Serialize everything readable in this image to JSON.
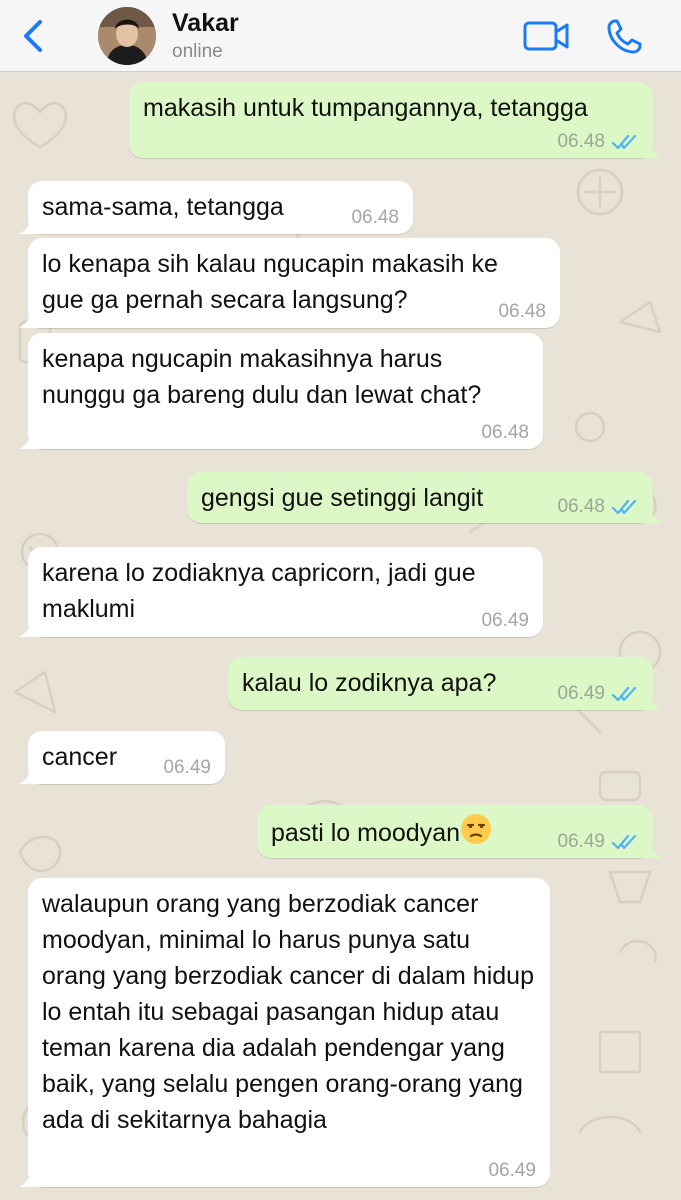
{
  "header": {
    "back_icon": "chevron-left-icon",
    "contact_name": "Vakar",
    "status": "online",
    "video_icon": "video-camera-icon",
    "call_icon": "phone-icon",
    "accent_color": "#1a7cf5"
  },
  "chat": {
    "wallpaper_color": "#e9e2d6",
    "incoming_bubble_color": "#ffffff",
    "outgoing_bubble_color": "#dcf8c6",
    "read_tick_color": "#4fb3f6",
    "messages": [
      {
        "dir": "out",
        "text": "makasih untuk tumpangannya, tetangga",
        "time": "06.48",
        "read": true
      },
      {
        "dir": "in",
        "text": "sama-sama, tetangga",
        "time": "06.48"
      },
      {
        "dir": "in",
        "text": "lo kenapa sih kalau ngucapin makasih ke gue ga pernah secara langsung?",
        "time": "06.48"
      },
      {
        "dir": "in",
        "text": "kenapa ngucapin makasihnya harus nunggu ga bareng dulu dan lewat chat?",
        "time": "06.48"
      },
      {
        "dir": "out",
        "text": "gengsi gue setinggi langit",
        "time": "06.48",
        "read": true
      },
      {
        "dir": "in",
        "text": "karena lo zodiaknya capricorn, jadi gue maklumi",
        "time": "06.49"
      },
      {
        "dir": "out",
        "text": "kalau lo zodiknya apa?",
        "time": "06.49",
        "read": true
      },
      {
        "dir": "in",
        "text": "cancer",
        "time": "06.49"
      },
      {
        "dir": "out",
        "text": "pasti lo moodyan",
        "emoji": "unamused-face-emoji",
        "time": "06.49",
        "read": true
      },
      {
        "dir": "in",
        "text": "walaupun orang yang berzodiak cancer moodyan, minimal lo harus punya satu orang yang berzodiak cancer di dalam hidup lo entah itu sebagai pasangan hidup atau teman karena dia adalah pendengar yang baik, yang selalu pengen orang-orang yang ada di sekitarnya bahagia",
        "time": "06.49"
      }
    ]
  }
}
